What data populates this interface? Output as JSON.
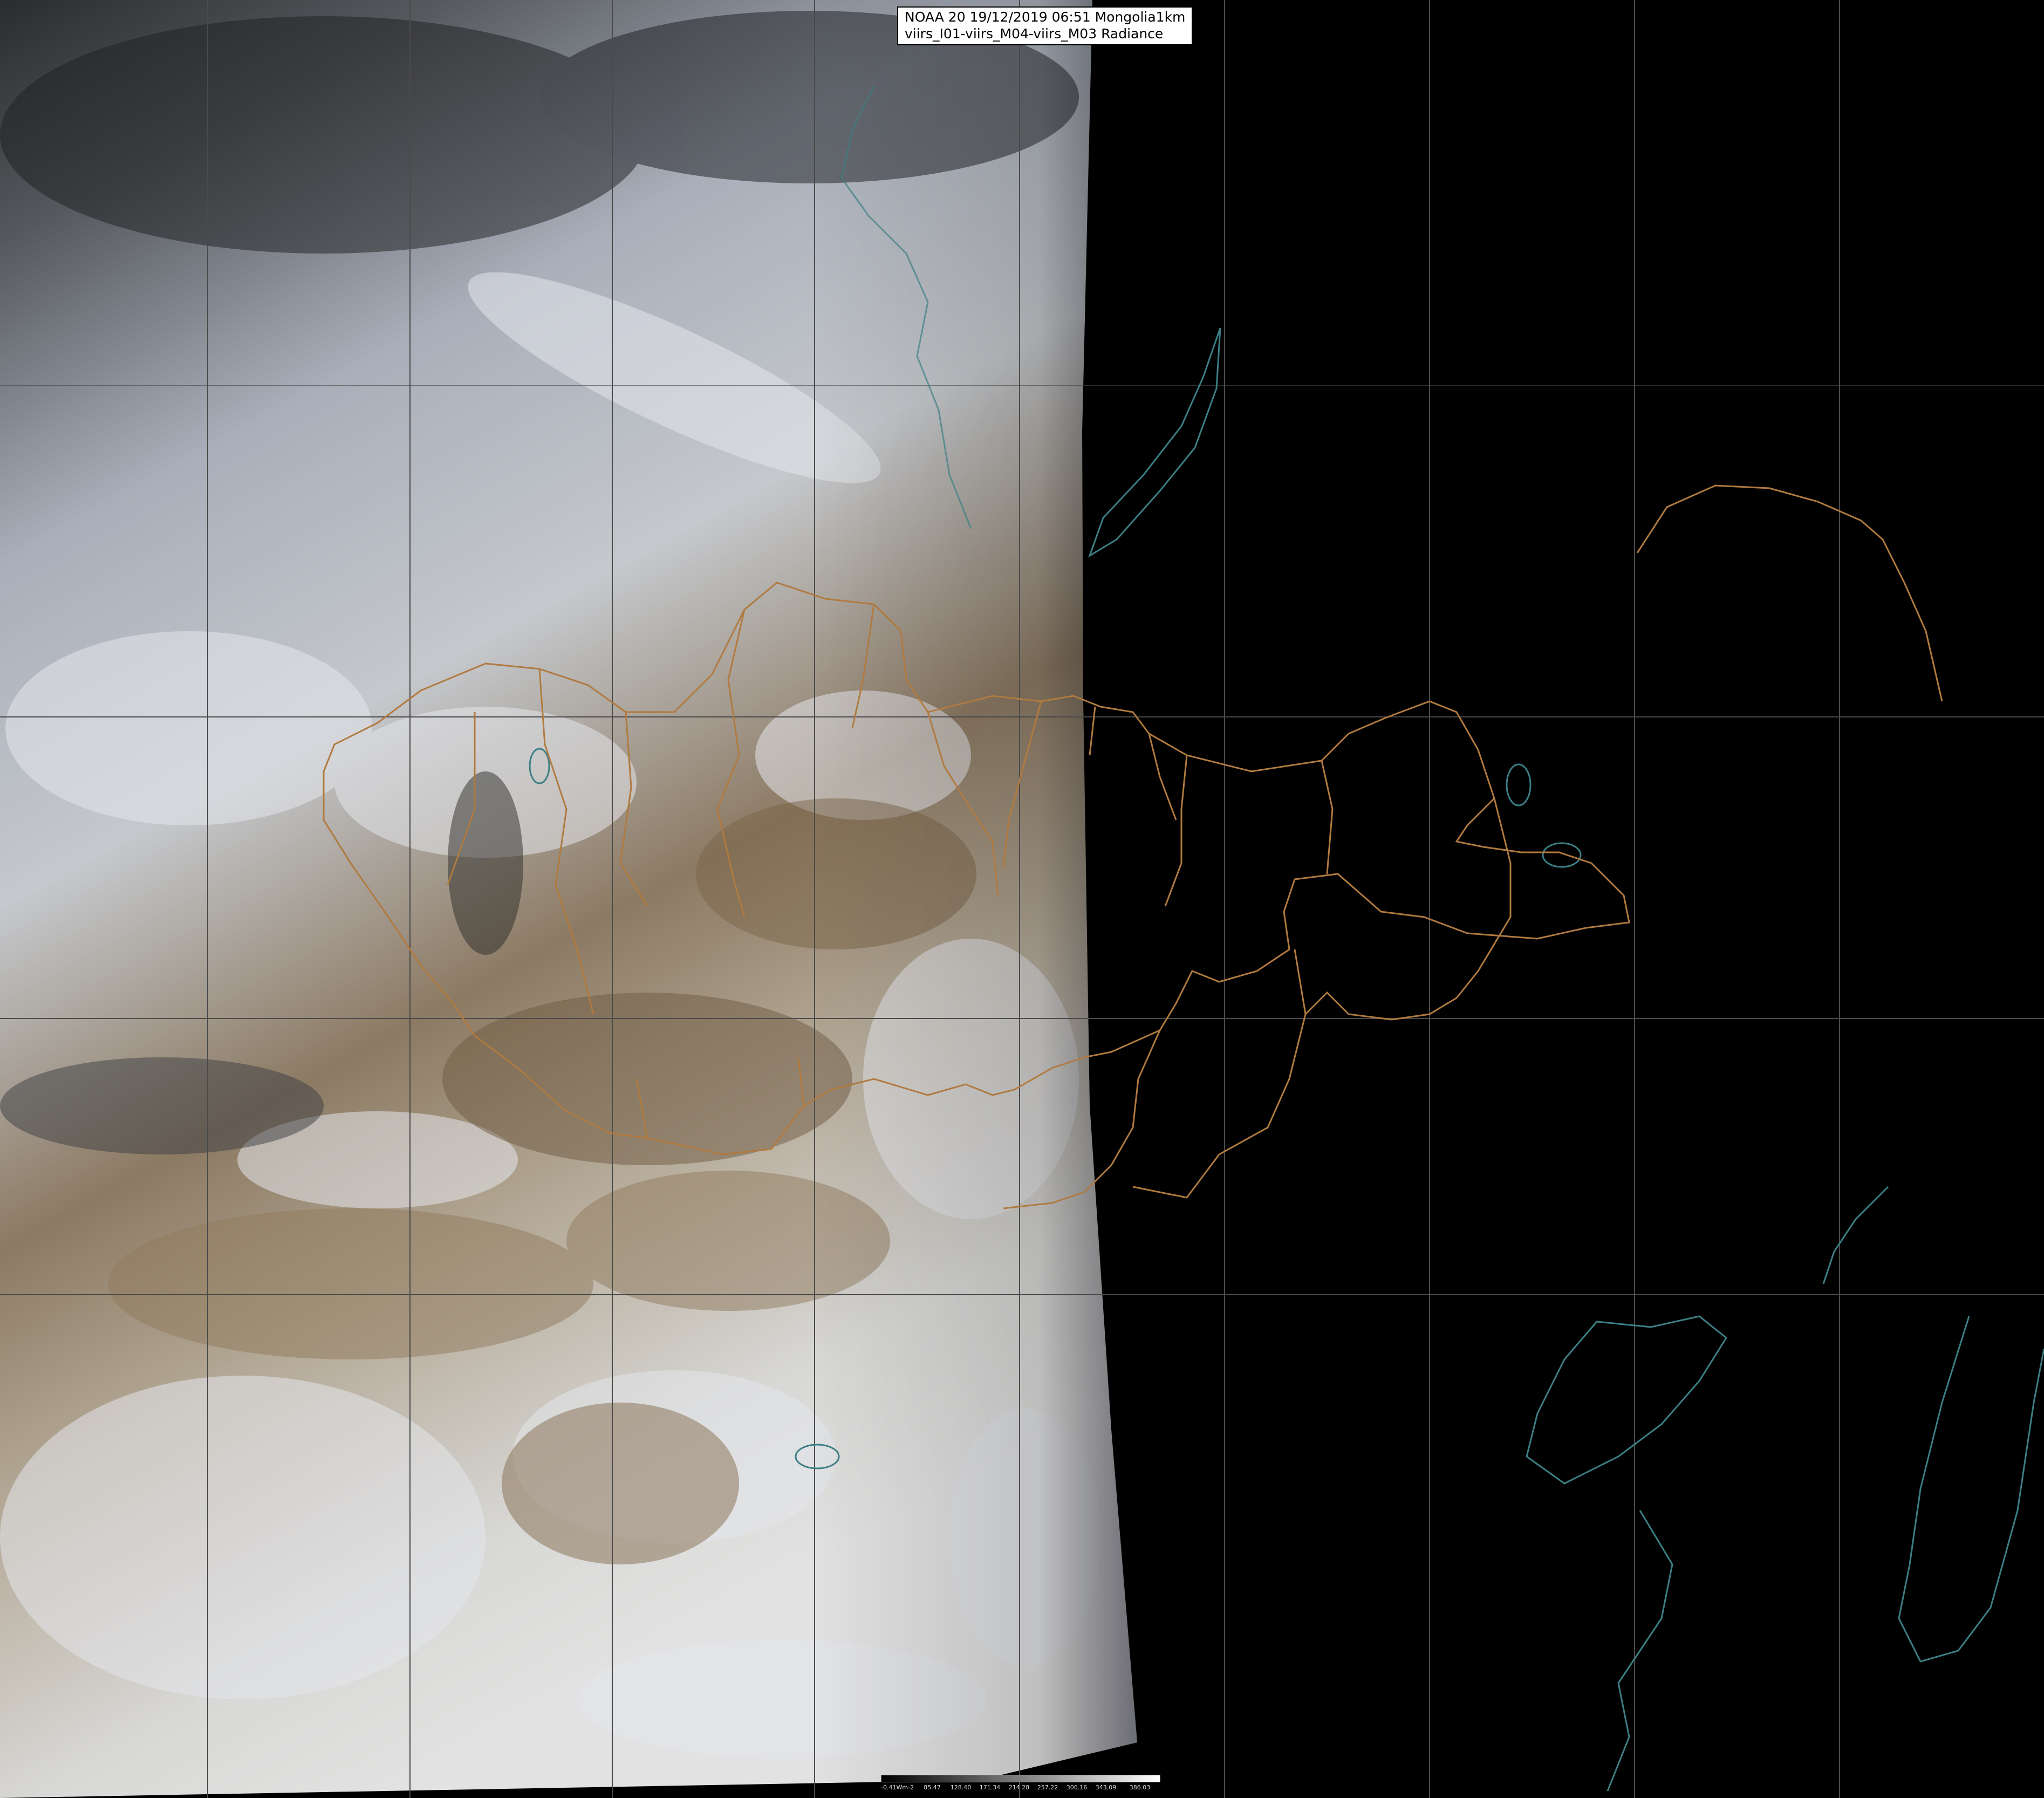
{
  "caption": {
    "line1": "NOAA 20 19/12/2019 06:51 Mongolia1km",
    "line2": "viirs_I01-viirs_M04-viirs_M03 Radiance"
  },
  "colorbar": {
    "ticks": [
      "-0.41Wm-2",
      "85.47",
      "128.40",
      "171.34",
      "214.28",
      "257.22",
      "300.16",
      "343.09",
      "386.03"
    ]
  },
  "colors": {
    "background": "#000000",
    "graticule": "#4a4a4a",
    "border_lines": "#b07a40",
    "coastline": "#3c7f84"
  }
}
